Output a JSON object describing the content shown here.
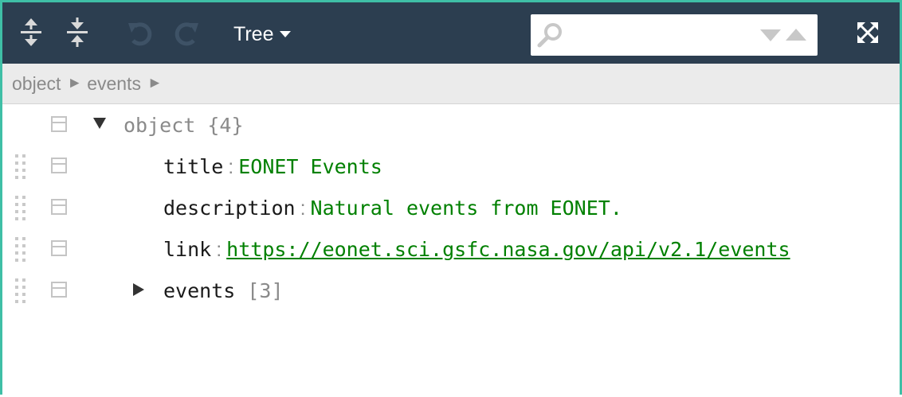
{
  "toolbar": {
    "mode_label": "Tree",
    "search_placeholder": "",
    "colors": {
      "background": "#2c3e50",
      "frame": "#3fbfa6"
    }
  },
  "navbar": {
    "crumbs": [
      "object",
      "events"
    ],
    "separator": "►"
  },
  "tree": {
    "root": {
      "field": "object",
      "count": "{4}"
    },
    "children": [
      {
        "field": "title",
        "separator": ":",
        "value": "EONET Events"
      },
      {
        "field": "description",
        "separator": ":",
        "value": "Natural events from EONET."
      },
      {
        "field": "link",
        "separator": ":",
        "value": "https://eonet.sci.gsfc.nasa.gov/api/v2.1/events"
      },
      {
        "field": "events",
        "count": "[3]"
      }
    ]
  }
}
